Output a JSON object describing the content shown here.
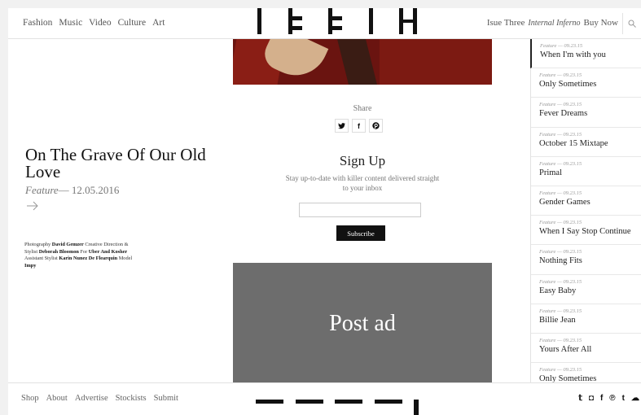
{
  "header": {
    "nav": [
      "Fashion",
      "Music",
      "Video",
      "Culture",
      "Art"
    ],
    "issue_prefix": "Isue Three",
    "issue_title": "Internal Inferno",
    "buy_now": "Buy Now"
  },
  "article": {
    "title": "On The Grave Of Our Old Love",
    "category": "Feature",
    "date": "— 12.05.2016",
    "credits": [
      {
        "label": "Photography ",
        "name": "David Gemzer"
      },
      {
        "label": " Creative Direction & Stylist ",
        "name": "Deborah Bloomon"
      },
      {
        "label": " For ",
        "name": "Uber And Kosher"
      },
      {
        "label": " Assistant Stylist ",
        "name": "Karin Nunez De Flearquin"
      },
      {
        "label": " Model ",
        "name": "Impy"
      }
    ]
  },
  "share": {
    "label": "Share",
    "icons": [
      "twitter-icon",
      "facebook-icon",
      "pinterest-icon"
    ]
  },
  "signup": {
    "title": "Sign Up",
    "text": "Stay up-to-date with killer content delivered straight to your inbox",
    "email_placeholder": "",
    "button": "Subscribe"
  },
  "ad": {
    "label": "Post ad"
  },
  "sidebar": {
    "items": [
      {
        "meta": "Feature — 09.23.15",
        "title": "When I'm with you"
      },
      {
        "meta": "Feature — 09.23.15",
        "title": "Only Sometimes"
      },
      {
        "meta": "Feature — 09.23.15",
        "title": "Fever Dreams"
      },
      {
        "meta": "Feature — 09.23.15",
        "title": "October 15 Mixtape"
      },
      {
        "meta": "Feature — 09.23.15",
        "title": "Primal"
      },
      {
        "meta": "Feature — 09.23.15",
        "title": "Gender Games"
      },
      {
        "meta": "Feature — 09.23.15",
        "title": "When I Say Stop Continue"
      },
      {
        "meta": "Feature — 09.23.15",
        "title": "Nothing Fits"
      },
      {
        "meta": "Feature — 09.23.15",
        "title": "Easy Baby"
      },
      {
        "meta": "Feature — 09.23.15",
        "title": "Billie Jean"
      },
      {
        "meta": "Feature — 09.23.15",
        "title": "Yours After All"
      },
      {
        "meta": "Feature — 09.23.15",
        "title": "Only Sometimes"
      }
    ]
  },
  "footer": {
    "nav": [
      "Shop",
      "About",
      "Advertise",
      "Stockists",
      "Submit"
    ],
    "social": [
      {
        "icon": "twitter-icon",
        "glyph": "𝕥"
      },
      {
        "icon": "instagram-icon",
        "glyph": "◘"
      },
      {
        "icon": "facebook-icon",
        "glyph": "f"
      },
      {
        "icon": "pinterest-icon",
        "glyph": "℗"
      },
      {
        "icon": "tumblr-icon",
        "glyph": "t"
      },
      {
        "icon": "soundcloud-icon",
        "glyph": "☁"
      }
    ]
  }
}
